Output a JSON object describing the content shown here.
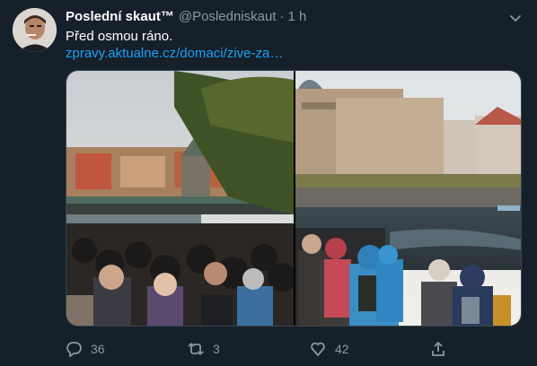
{
  "tweet": {
    "author_name": "Poslední skaut™",
    "handle": "@Posledniskaut",
    "separator": "·",
    "time": "1 h",
    "text": "Před osmou ráno.",
    "link": "zpravy.aktualne.cz/domaci/zive-za…",
    "media_left_icon": "photo-crowd-bridge",
    "media_right_icon": "photo-crowd-riverbank"
  },
  "actions": {
    "reply_count": "36",
    "retweet_count": "3",
    "like_count": "42"
  },
  "icons": {
    "reply": "reply-icon",
    "retweet": "retweet-icon",
    "like": "heart-icon",
    "share": "share-icon",
    "more": "chevron-down-icon"
  },
  "colors": {
    "background": "#15202b",
    "link": "#1da1f2",
    "muted": "#8899a6"
  }
}
